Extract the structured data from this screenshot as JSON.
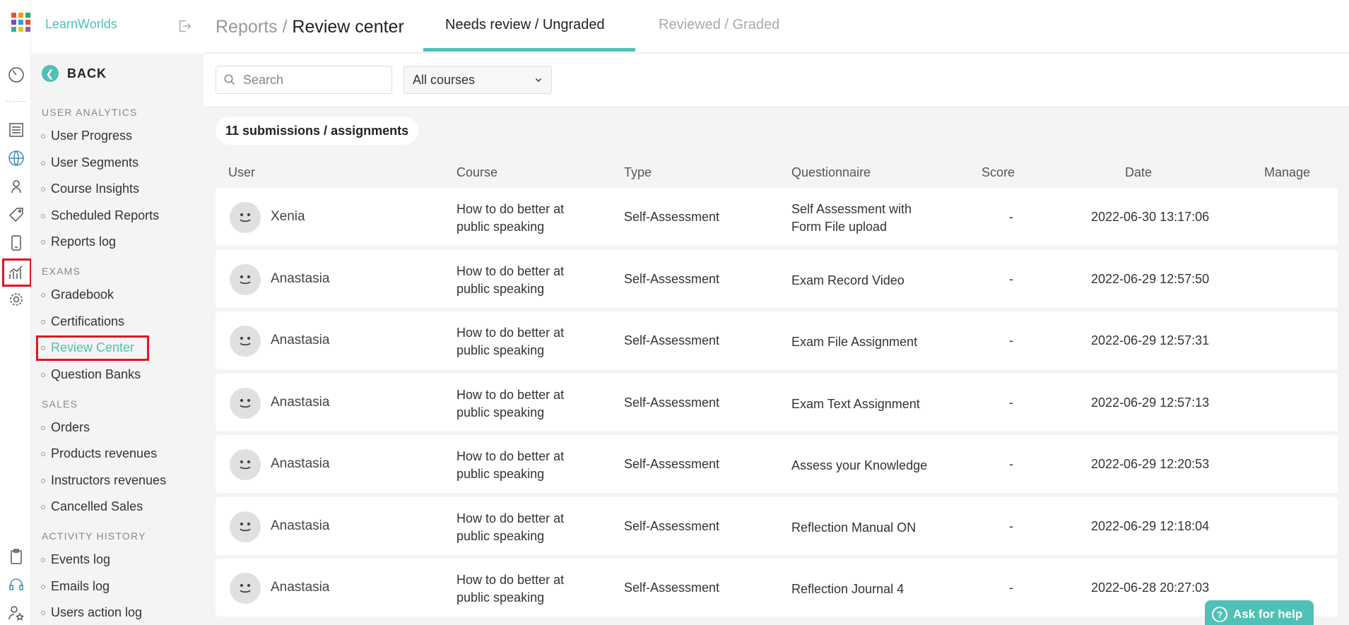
{
  "brand": {
    "name": "LearnWorlds",
    "accent": "#4fc1b6",
    "highlight": "#e0171f"
  },
  "rail": {
    "icons": [
      "dashboard-icon",
      "pages-icon",
      "website-icon",
      "users-icon",
      "marketing-icon",
      "mobile-icon",
      "reports-icon",
      "settings-icon",
      "clipboard-icon",
      "support-icon",
      "users-star-icon"
    ]
  },
  "menu": {
    "back": "BACK",
    "sections": [
      {
        "title": "USER ANALYTICS",
        "items": [
          "User Progress",
          "User Segments",
          "Course Insights",
          "Scheduled Reports",
          "Reports log"
        ]
      },
      {
        "title": "EXAMS",
        "items": [
          "Gradebook",
          "Certifications",
          "Review Center",
          "Question Banks"
        ]
      },
      {
        "title": "SALES",
        "items": [
          "Orders",
          "Products revenues",
          "Instructors revenues",
          "Cancelled Sales"
        ]
      },
      {
        "title": "ACTIVITY HISTORY",
        "items": [
          "Events log",
          "Emails log",
          "Users action log"
        ]
      }
    ]
  },
  "header": {
    "crumb_parent": "Reports /",
    "crumb_current": "Review center",
    "tabs": [
      {
        "label": "Needs review / Ungraded",
        "active": true
      },
      {
        "label": "Reviewed / Graded",
        "active": false
      }
    ]
  },
  "filters": {
    "search_placeholder": "Search",
    "course_select": "All courses"
  },
  "summary": "11 submissions / assignments",
  "table": {
    "columns": [
      "User",
      "Course",
      "Type",
      "Questionnaire",
      "Score",
      "Date",
      "Manage"
    ],
    "rows": [
      {
        "user": "Xenia",
        "course1": "How to do better at",
        "course2": "public speaking",
        "type": "Self-Assessment",
        "q1": "Self Assessment with",
        "q2": "Form File upload",
        "score": "-",
        "date": "2022-06-30 13:17:06"
      },
      {
        "user": "Anastasia",
        "course1": "How to do better at",
        "course2": "public speaking",
        "type": "Self-Assessment",
        "q1": "Exam Record Video",
        "q2": "",
        "score": "-",
        "date": "2022-06-29 12:57:50"
      },
      {
        "user": "Anastasia",
        "course1": "How to do better at",
        "course2": "public speaking",
        "type": "Self-Assessment",
        "q1": "Exam File Assignment",
        "q2": "",
        "score": "-",
        "date": "2022-06-29 12:57:31"
      },
      {
        "user": "Anastasia",
        "course1": "How to do better at",
        "course2": "public speaking",
        "type": "Self-Assessment",
        "q1": "Exam Text Assignment",
        "q2": "",
        "score": "-",
        "date": "2022-06-29 12:57:13"
      },
      {
        "user": "Anastasia",
        "course1": "How to do better at",
        "course2": "public speaking",
        "type": "Self-Assessment",
        "q1": "Assess your Knowledge",
        "q2": "",
        "score": "-",
        "date": "2022-06-29 12:20:53"
      },
      {
        "user": "Anastasia",
        "course1": "How to do better at",
        "course2": "public speaking",
        "type": "Self-Assessment",
        "q1": "Reflection Manual ON",
        "q2": "",
        "score": "-",
        "date": "2022-06-29 12:18:04"
      },
      {
        "user": "Anastasia",
        "course1": "How to do better at",
        "course2": "public speaking",
        "type": "Self-Assessment",
        "q1": "Reflection Journal 4",
        "q2": "",
        "score": "-",
        "date": "2022-06-28 20:27:03"
      }
    ]
  },
  "help_button": "Ask for help"
}
